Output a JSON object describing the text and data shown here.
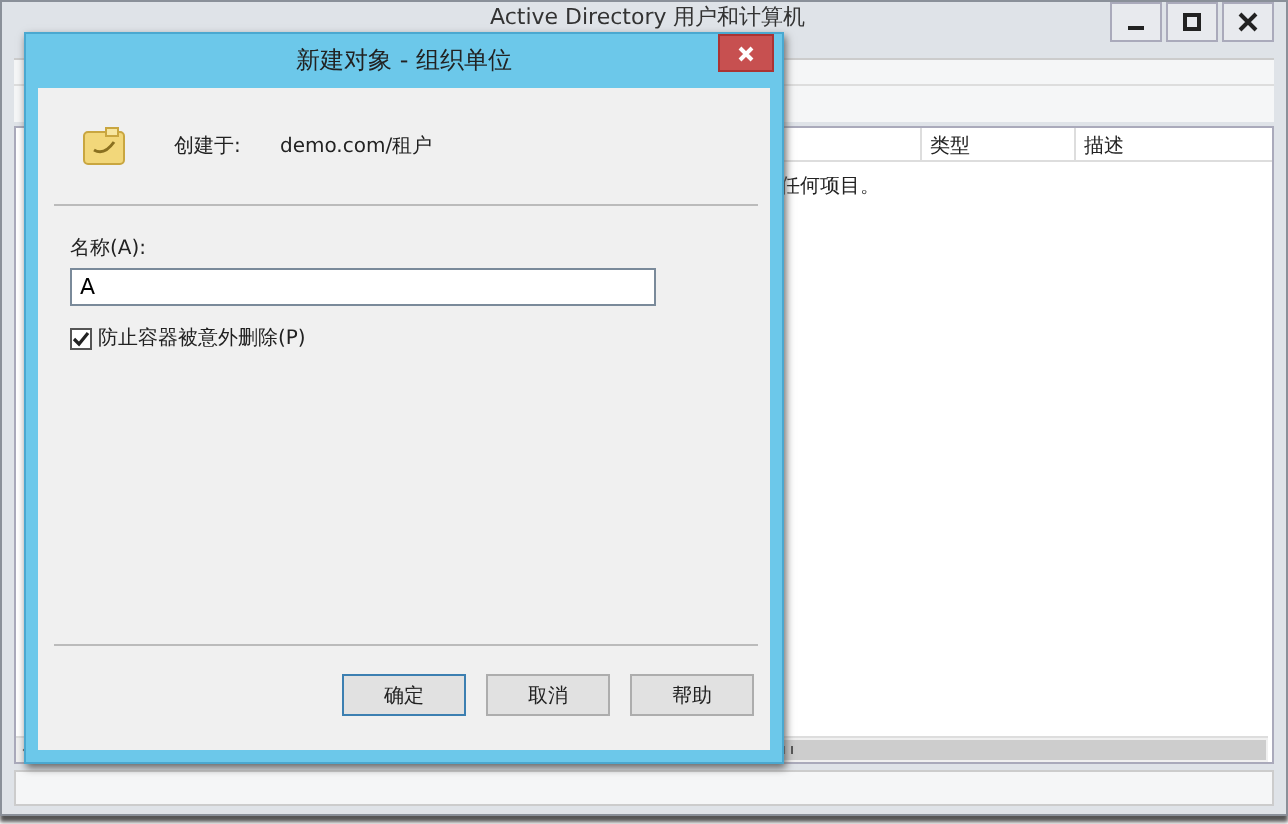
{
  "main_window": {
    "title": "Active Directory 用户和计算机",
    "columns": [
      "类型",
      "描述"
    ],
    "empty_message": "任何项目。"
  },
  "dialog": {
    "title": "新建对象 - 组织单位",
    "created_in_label": "创建于:",
    "created_in_path": "demo.com/租户",
    "name_label": "名称(A):",
    "name_value": "A",
    "protect_checkbox": {
      "label": "防止容器被意外删除(P)",
      "checked": true
    },
    "buttons": [
      "确定",
      "取消",
      "帮助"
    ]
  }
}
